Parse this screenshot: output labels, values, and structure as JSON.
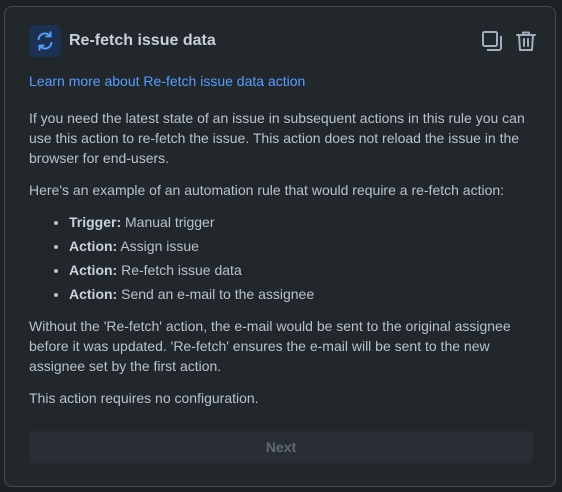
{
  "panel": {
    "title": "Re-fetch issue data",
    "icon": "refresh-icon",
    "actions": [
      {
        "name": "duplicate-icon"
      },
      {
        "name": "trash-icon"
      }
    ]
  },
  "link": {
    "text": "Learn more about Re-fetch issue data action"
  },
  "body": {
    "intro": "If you need the latest state of an issue in subsequent actions in this rule you can use this action to re-fetch the issue. This action does not reload the issue in the browser for end-users.",
    "example_intro": "Here's an example of an automation rule that would require a re-fetch action:",
    "steps": [
      {
        "label": "Trigger:",
        "text": " Manual trigger"
      },
      {
        "label": "Action:",
        "text": " Assign issue"
      },
      {
        "label": "Action:",
        "text": " Re-fetch issue data"
      },
      {
        "label": "Action:",
        "text": " Send an e-mail to the assignee"
      }
    ],
    "explanation": "Without the 'Re-fetch' action, the e-mail would be sent to the original assignee before it was updated. 'Re-fetch' ensures the e-mail will be sent to the new assignee set by the first action.",
    "config_note": "This action requires no configuration."
  },
  "footer": {
    "next_label": "Next"
  },
  "colors": {
    "accent": "#579dff",
    "icon_bg": "#1c3152"
  }
}
